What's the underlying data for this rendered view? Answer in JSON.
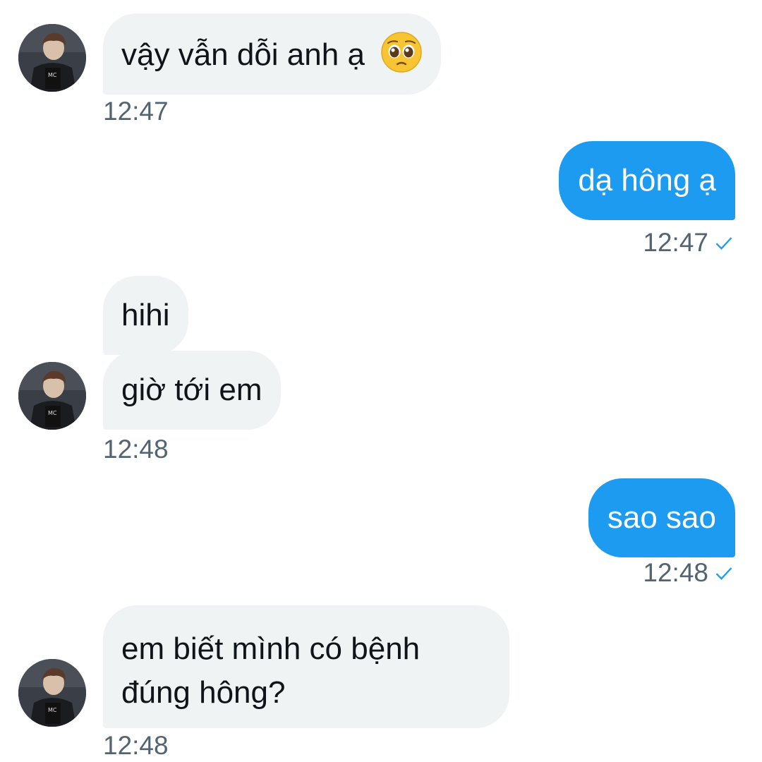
{
  "conversation": {
    "messages": [
      {
        "text": "vậy vẫn dỗi anh ạ",
        "emoji": "pleading-face-emoji",
        "time": "12:47"
      },
      {
        "text": "dạ hông ạ",
        "time": "12:47",
        "status_icon": "checkmark-icon"
      },
      {
        "text": "hihi"
      },
      {
        "text": "giờ tới em",
        "time": "12:48"
      },
      {
        "text": "sao sao",
        "time": "12:48",
        "status_icon": "checkmark-icon"
      },
      {
        "line1": "em biết mình có bệnh",
        "line2": "đúng hông?",
        "time": "12:48"
      }
    ]
  },
  "colors": {
    "incoming_bubble": "#eff3f4",
    "outgoing_bubble": "#1d9bf0",
    "timestamp": "#536471",
    "check": "#1d9bf0"
  }
}
